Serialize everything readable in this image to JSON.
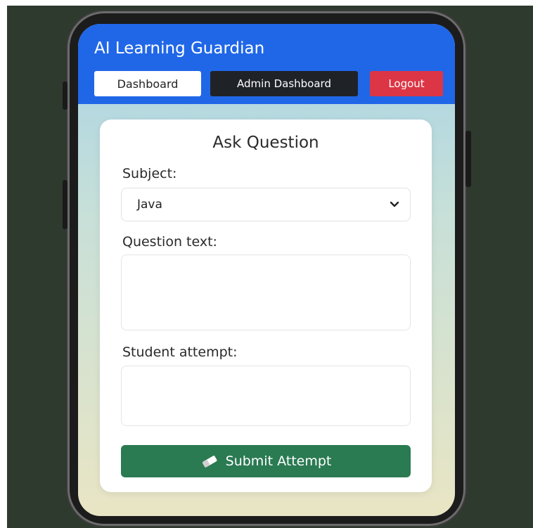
{
  "app": {
    "title": "AI Learning Guardian"
  },
  "nav": {
    "dashboard": "Dashboard",
    "admin_dashboard": "Admin Dashboard",
    "logout": "Logout"
  },
  "form": {
    "title": "Ask Question",
    "subject_label": "Subject:",
    "subject_value": "Java",
    "subject_options": [
      "Java"
    ],
    "question_label": "Question text:",
    "question_value": "",
    "attempt_label": "Student attempt:",
    "attempt_value": "",
    "submit_label": "Submit Attempt",
    "submit_icon": "eraser-icon"
  },
  "colors": {
    "header": "#2067e8",
    "logout": "#dc3545",
    "admin": "#1f2328",
    "submit": "#2a7a52"
  }
}
